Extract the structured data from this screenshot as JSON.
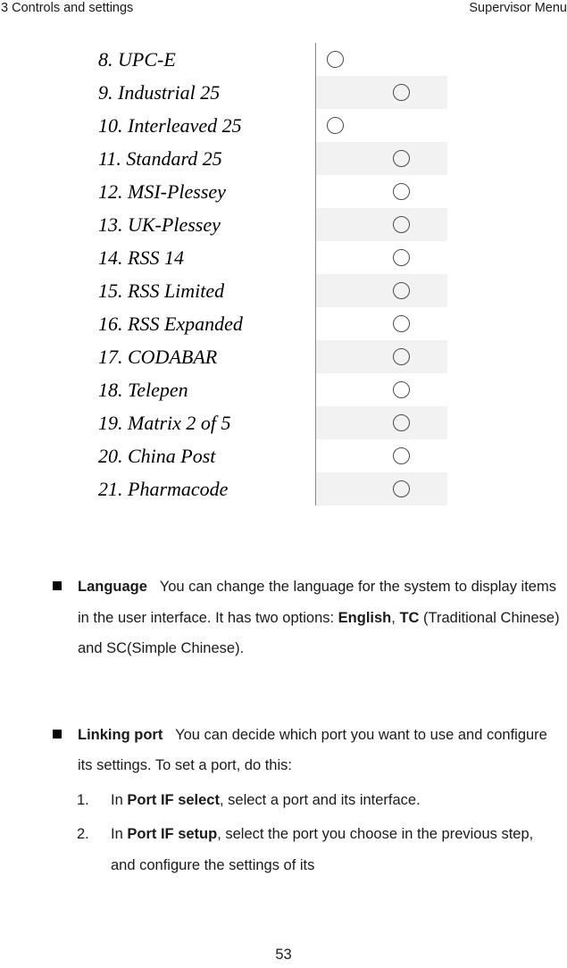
{
  "header": {
    "left": "3 Controls and settings",
    "right": "Supervisor Menu"
  },
  "symbology_table": {
    "rows": [
      {
        "label": "8. UPC-E",
        "radio_position": "left",
        "shaded": false
      },
      {
        "label": "9. Industrial 25",
        "radio_position": "center",
        "shaded": true
      },
      {
        "label": "10. Interleaved 25",
        "radio_position": "left",
        "shaded": false
      },
      {
        "label": "11. Standard 25",
        "radio_position": "center",
        "shaded": true
      },
      {
        "label": "12. MSI-Plessey",
        "radio_position": "center",
        "shaded": false
      },
      {
        "label": "13. UK-Plessey",
        "radio_position": "center",
        "shaded": true
      },
      {
        "label": "14. RSS 14",
        "radio_position": "center",
        "shaded": false
      },
      {
        "label": "15. RSS Limited",
        "radio_position": "center",
        "shaded": true
      },
      {
        "label": "16. RSS Expanded",
        "radio_position": "center",
        "shaded": false
      },
      {
        "label": "17. CODABAR",
        "radio_position": "center",
        "shaded": true
      },
      {
        "label": "18. Telepen",
        "radio_position": "center",
        "shaded": false
      },
      {
        "label": "19. Matrix 2 of 5",
        "radio_position": "center",
        "shaded": true
      },
      {
        "label": "20. China Post",
        "radio_position": "center",
        "shaded": false
      },
      {
        "label": "21. Pharmacode",
        "radio_position": "center",
        "shaded": true
      }
    ]
  },
  "body": {
    "language_bullet": {
      "term": "Language",
      "gap": "   ",
      "text_1": "You can change the language for the system to display items in the user interface. It has two options: ",
      "bold_1": "English",
      "text_2": ", ",
      "bold_2": "TC",
      "text_3": " (Traditional Chinese) and SC(Simple Chinese)."
    },
    "linking_bullet": {
      "term": "Linking port",
      "gap": "   ",
      "text_1": "You can decide which port you want to use and configure its settings. To set a port, do this:"
    },
    "steps": [
      {
        "number": "1.",
        "text_1": "In ",
        "bold_1": "Port IF select",
        "text_2": ", select a port and its interface."
      },
      {
        "number": "2.",
        "text_1": "In ",
        "bold_1": "Port IF setup",
        "text_2": ", select the port you choose in the previous step, and configure the settings of its"
      }
    ]
  },
  "footer": {
    "page_number": "53"
  }
}
